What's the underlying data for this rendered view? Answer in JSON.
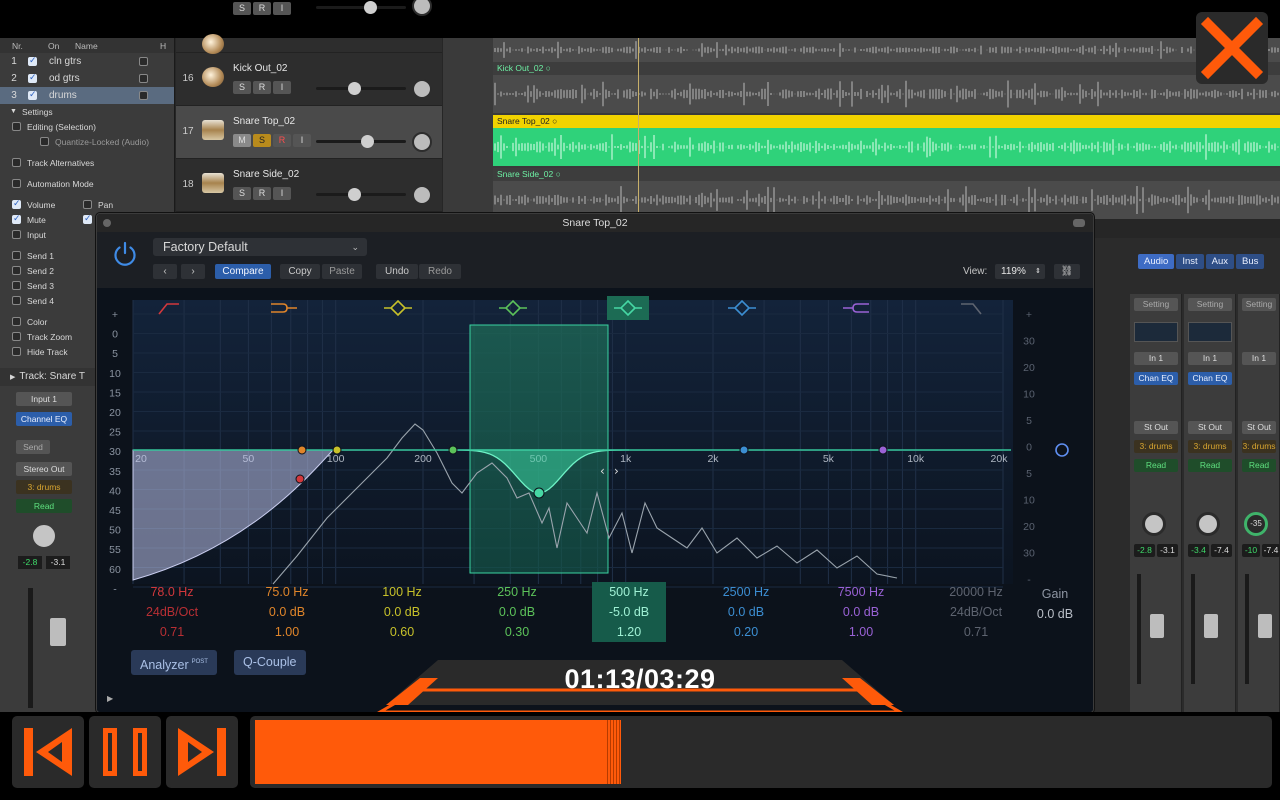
{
  "inspector": {
    "groups_header": [
      "Nr.",
      "On",
      "Name",
      "H"
    ],
    "groups": [
      {
        "nr": "1",
        "on": true,
        "name": "cln gtrs"
      },
      {
        "nr": "2",
        "on": true,
        "name": "od gtrs"
      },
      {
        "nr": "3",
        "on": true,
        "name": "drums"
      }
    ],
    "settings_label": "Settings",
    "editing": "Editing (Selection)",
    "quantize": "Quantize-Locked (Audio)",
    "track_alternatives": "Track Alternatives",
    "automation_mode": "Automation Mode",
    "volume": "Volume",
    "pan": "Pan",
    "mute": "Mute",
    "input": "Input",
    "send1": "Send 1",
    "send2": "Send 2",
    "send3": "Send 3",
    "send4": "Send 4",
    "color": "Color",
    "track_zoom": "Track Zoom",
    "hide_track": "Hide Track",
    "track_label": "Track:",
    "track_name": "Snare T",
    "strip": {
      "input": "Input 1",
      "channel_eq": "Channel EQ",
      "send": "Send",
      "stereo_out": "Stereo Out",
      "group": "3: drums",
      "read": "Read",
      "vol_l": "-2.8",
      "vol_r": "-3.1"
    }
  },
  "tracks": [
    {
      "num": "16",
      "name": "Kick Out_02",
      "type": "kick"
    },
    {
      "num": "17",
      "name": "Snare Top_02",
      "type": "snare",
      "selected": true
    },
    {
      "num": "18",
      "name": "Snare Side_02",
      "type": "snare"
    }
  ],
  "regions": [
    {
      "name": "Kick Out_02"
    },
    {
      "name": "Snare Top_02"
    },
    {
      "name": "Snare Side_02"
    }
  ],
  "mixer": {
    "tabs": [
      "Audio",
      "Inst",
      "Aux",
      "Bus"
    ],
    "channels": [
      {
        "setting": "Setting",
        "input": "In 1",
        "eq": "Chan EQ",
        "out": "St Out",
        "group": "3: drums",
        "read": "Read",
        "l": "-2.8",
        "r": "-3.1"
      },
      {
        "setting": "Setting",
        "input": "In 1",
        "eq": "Chan EQ",
        "out": "St Out",
        "group": "3: drums",
        "read": "Read",
        "l": "-3.4",
        "r": "-7.4"
      },
      {
        "setting": "Setting",
        "input": "In 1",
        "eq": "",
        "out": "St Out",
        "group": "3: drums",
        "read": "Read",
        "l": "-10",
        "r": "-7.4",
        "pan": "-35"
      }
    ]
  },
  "eq": {
    "title": "Snare Top_02",
    "preset": "Factory Default",
    "compare": "Compare",
    "copy": "Copy",
    "paste": "Paste",
    "undo": "Undo",
    "redo": "Redo",
    "view_label": "View:",
    "view_value": "119%",
    "db_left": [
      "+",
      "0",
      "5",
      "10",
      "15",
      "20",
      "25",
      "30",
      "35",
      "40",
      "45",
      "50",
      "55",
      "60",
      "-"
    ],
    "db_right": [
      "+",
      "30",
      "20",
      "10",
      "5",
      "0",
      "5",
      "10",
      "20",
      "30",
      "-"
    ],
    "freq_labels": [
      "20",
      "50",
      "100",
      "200",
      "500",
      "1k",
      "2k",
      "5k",
      "10k",
      "20k"
    ],
    "bands": [
      {
        "freq": "78.0 Hz",
        "gain": "24dB/Oct",
        "q": "0.71",
        "color": "#d2383c"
      },
      {
        "freq": "75.0 Hz",
        "gain": "0.0 dB",
        "q": "1.00",
        "color": "#e0852a"
      },
      {
        "freq": "100 Hz",
        "gain": "0.0 dB",
        "q": "0.60",
        "color": "#c7c12a"
      },
      {
        "freq": "250 Hz",
        "gain": "0.0 dB",
        "q": "0.30",
        "color": "#5cc25a"
      },
      {
        "freq": "500 Hz",
        "gain": "-5.0 dB",
        "q": "1.20",
        "color": "#46d7a4",
        "selected": true
      },
      {
        "freq": "2500 Hz",
        "gain": "0.0 dB",
        "q": "0.20",
        "color": "#3c8ed2"
      },
      {
        "freq": "7500 Hz",
        "gain": "0.0 dB",
        "q": "1.00",
        "color": "#9a62d6"
      },
      {
        "freq": "20000 Hz",
        "gain": "24dB/Oct",
        "q": "0.71",
        "color": "#5e6470"
      }
    ],
    "gain_label": "Gain",
    "gain_value": "0.0 dB",
    "analyzer": "Analyzer",
    "analyzer_badge": "POST",
    "qcouple": "Q-Couple"
  },
  "player": {
    "time": "01:13/03:29",
    "progress": 0.36,
    "accent": "#ff5a0a"
  }
}
